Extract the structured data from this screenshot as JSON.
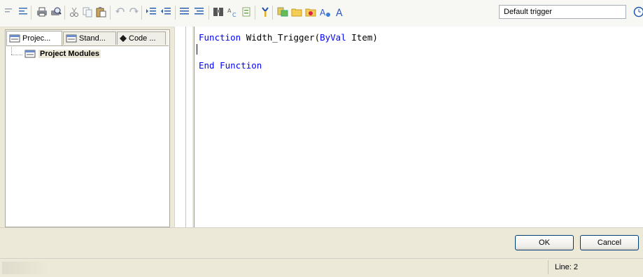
{
  "toolbar": {
    "icons": [
      "align-left-icon",
      "align-icon",
      "print-icon",
      "print-preview-icon",
      "cut-icon",
      "copy-icon",
      "paste-icon",
      "undo-icon",
      "redo-icon",
      "indent-icon",
      "outdent-icon",
      "comment-icon",
      "uncomment-icon",
      "find-icon",
      "replace-icon",
      "goto-icon",
      "debug-icon",
      "insert-field-icon",
      "open-folder-icon",
      "add-folder-icon",
      "font-color-icon",
      "font-icon"
    ],
    "trigger_value": "Default trigger",
    "clock_icon": "clock-icon"
  },
  "left_panel": {
    "tabs": [
      {
        "label": "Projec...",
        "icon": "module-icon"
      },
      {
        "label": "Stand...",
        "icon": "module-icon"
      },
      {
        "label": "Code ...",
        "icon": "diamond-icon"
      }
    ],
    "tree": {
      "root_label": "Project Modules",
      "root_icon": "module-icon"
    }
  },
  "editor": {
    "lines": [
      {
        "kw1": "Function",
        "mid": " Width_Trigger(",
        "kw2": "ByVal",
        "tail": " Item)"
      },
      {
        "text": ""
      },
      {
        "kw1": "End Function"
      }
    ],
    "colors": {
      "keyword": "#0000ff",
      "text": "#000000"
    }
  },
  "buttons": {
    "ok": "OK",
    "cancel": "Cancel"
  },
  "status": {
    "line": "Line: 2"
  }
}
